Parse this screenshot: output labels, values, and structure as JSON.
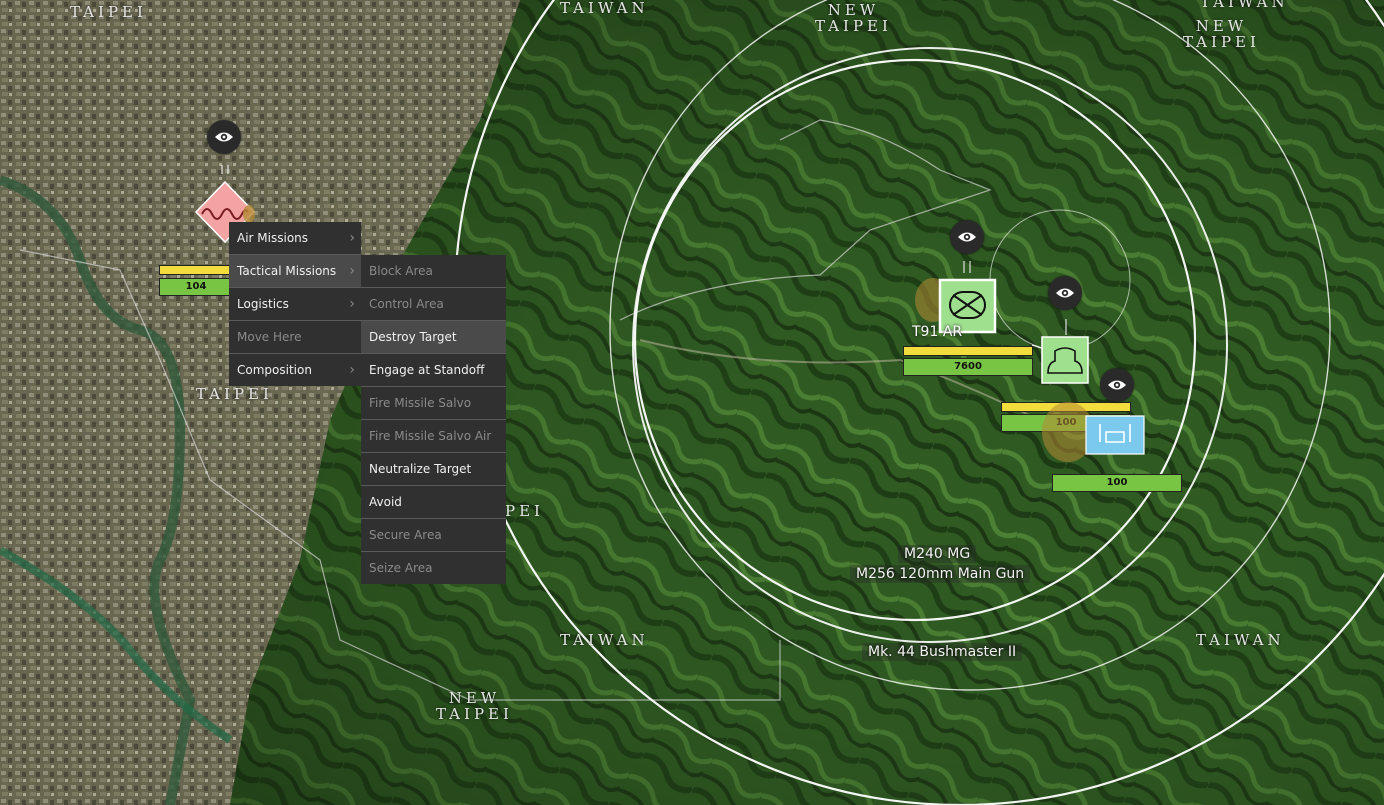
{
  "map": {
    "place_labels": [
      {
        "id": "taipei-top-left",
        "text": "TAIPEI"
      },
      {
        "id": "taiwan-top",
        "text": "TAIWAN"
      },
      {
        "id": "new-taipei-top",
        "text": "NEW\nTAIPEI"
      },
      {
        "id": "taiwan-top-right",
        "text": "TAIWAN"
      },
      {
        "id": "new-taipei-top-right",
        "text": "NEW\nTAIPEI"
      },
      {
        "id": "taipei-mid",
        "text": "TAIPEI"
      },
      {
        "id": "taiwan-bottom",
        "text": "TAIWAN"
      },
      {
        "id": "new-taipei-bottom",
        "text": "NEW\nTAIPEI"
      },
      {
        "id": "taiwan-bottom-right",
        "text": "TAIWAN"
      },
      {
        "id": "pei-fragment",
        "text": "PEI"
      }
    ]
  },
  "units": [
    {
      "id": "hostile-unit",
      "color": "#f08a8a",
      "health_value": "104",
      "health_fraction": 1.0,
      "status_fraction": 1.0
    },
    {
      "id": "t91-ar-unit",
      "label": "T91 AR",
      "color": "#9ee08e",
      "health_value": "7600",
      "health_fraction": 1.0,
      "status_fraction": 1.0
    },
    {
      "id": "armor-unit",
      "color": "#9ee08e",
      "health_value": "100",
      "health_fraction": 1.0,
      "status_fraction": 1.0
    },
    {
      "id": "support-unit",
      "color": "#7cc9ee",
      "health_value": "100",
      "health_fraction": 1.0
    }
  ],
  "weapon_labels": [
    "M240 MG",
    "M256 120mm Main Gun",
    "Mk. 44 Bushmaster II"
  ],
  "context_menu": {
    "items": [
      {
        "label": "Air Missions",
        "submenu": true,
        "enabled": true
      },
      {
        "label": "Tactical Missions",
        "submenu": true,
        "enabled": true,
        "highlighted": true
      },
      {
        "label": "Logistics",
        "submenu": true,
        "enabled": true
      },
      {
        "label": "Move Here",
        "submenu": false,
        "enabled": false
      },
      {
        "label": "Composition",
        "submenu": true,
        "enabled": true
      }
    ],
    "submenu_arrow": "›"
  },
  "tactical_submenu": {
    "items": [
      {
        "label": "Block Area",
        "enabled": false
      },
      {
        "label": "Control Area",
        "enabled": false
      },
      {
        "label": "Destroy Target",
        "enabled": true,
        "highlighted": true
      },
      {
        "label": "Engage at Standoff",
        "enabled": true
      },
      {
        "label": "Fire Missile Salvo",
        "enabled": false
      },
      {
        "label": "Fire Missile Salvo Air",
        "enabled": false
      },
      {
        "label": "Neutralize Target",
        "enabled": true
      },
      {
        "label": "Avoid",
        "enabled": true
      },
      {
        "label": "Secure Area",
        "enabled": false
      },
      {
        "label": "Seize Area",
        "enabled": false
      }
    ]
  },
  "icons": [
    "eye-icon",
    "hostile-diamond-icon",
    "infantry-symbol-icon",
    "armor-symbol-icon",
    "support-symbol-icon"
  ]
}
